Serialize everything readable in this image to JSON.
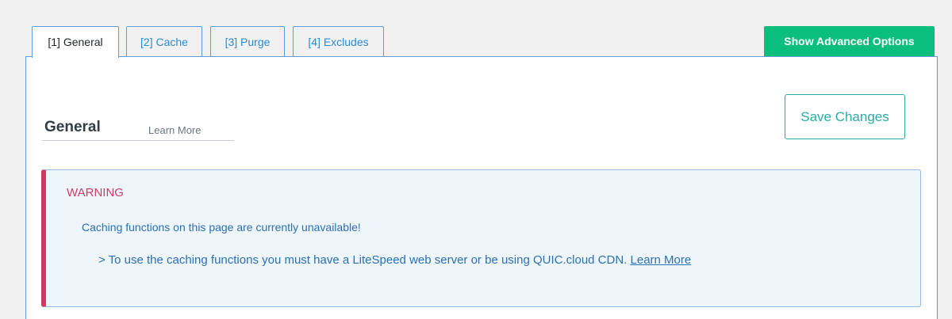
{
  "tabs": [
    {
      "label": "[1] General",
      "active": true
    },
    {
      "label": "[2] Cache",
      "active": false
    },
    {
      "label": "[3] Purge",
      "active": false
    },
    {
      "label": "[4] Excludes",
      "active": false
    }
  ],
  "advanced_button": "Show Advanced Options",
  "section": {
    "title": "General",
    "learn_more": "Learn More"
  },
  "save_button": "Save Changes",
  "warning": {
    "title": "WARNING",
    "message": "Caching functions on this page are currently unavailable!",
    "detail_prefix": "> To use the caching functions you must have a LiteSpeed web server or be using QUIC.cloud CDN.",
    "detail_link": "Learn More"
  },
  "colors": {
    "accent_green": "#0abf7e",
    "link_blue": "#2c8ad6",
    "warning_red": "#d03a61",
    "teal": "#2aaba8"
  }
}
